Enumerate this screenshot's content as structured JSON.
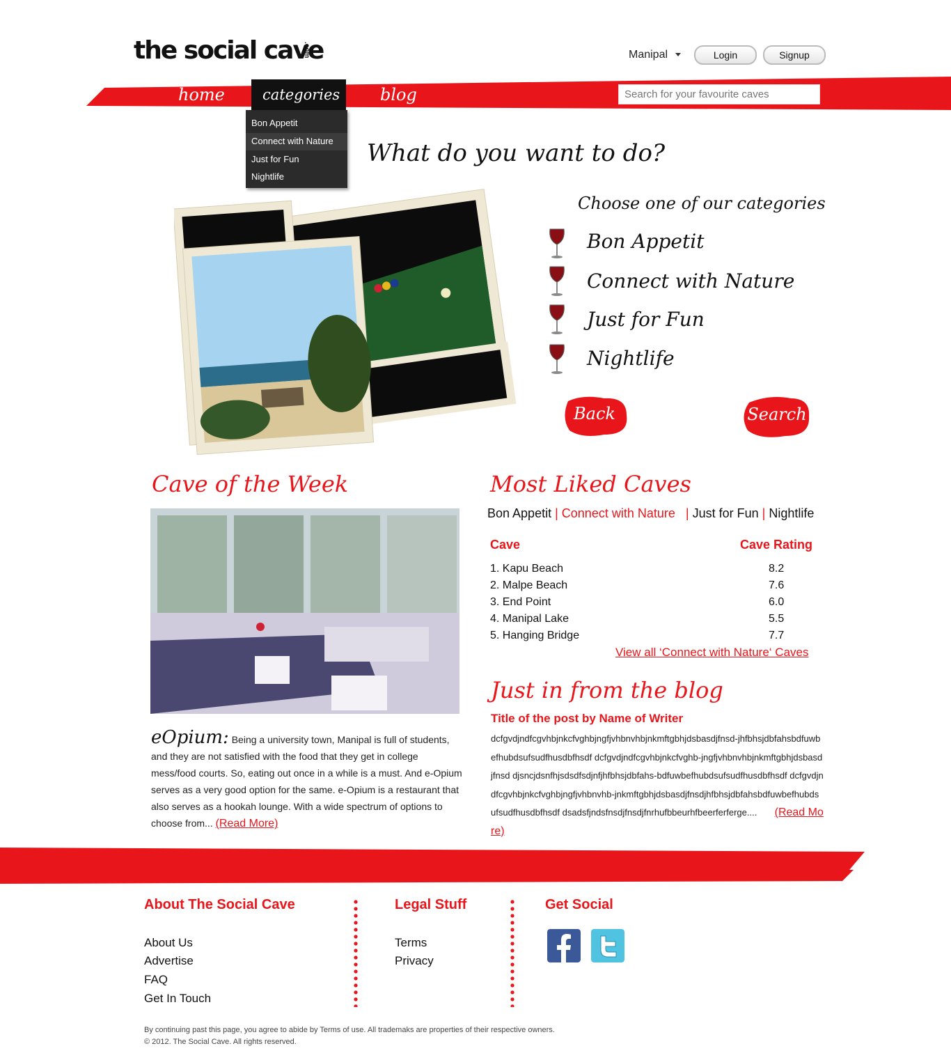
{
  "header": {
    "logo_text": "the social cave",
    "logo_suffix": ".com",
    "city": "Manipal",
    "login_label": "Login",
    "signup_label": "Signup"
  },
  "nav": {
    "home": "home",
    "categories": "categories",
    "blog": "blog",
    "search_placeholder": "Search for your favourite caves",
    "dropdown_items": [
      "Bon Appetit",
      "Connect with Nature",
      "Just for Fun",
      "Nightlife"
    ]
  },
  "hero": {
    "title": "What do you want to do?",
    "subtitle": "Choose one of our categories",
    "categories": [
      "Bon Appetit",
      "Connect with Nature",
      "Just for Fun",
      "Nightlife"
    ],
    "back_label": "Back",
    "search_label": "Search"
  },
  "cave_of_week": {
    "title": "Cave of the Week",
    "name": "eOpium:",
    "text": "Being a university town, Manipal is full of students, and they are not satisfied with the food that they get in college mess/food courts. So, eating out once in a while is a must. And e-Opium serves as a very good option for the same. e-Opium is a restaurant that also serves as a hookah lounge. With a wide spectrum of options to choose from...",
    "read_more": "(Read More)"
  },
  "most_liked": {
    "title": "Most Liked Caves",
    "filters": [
      "Bon Appetit",
      "Connect with Nature",
      "Just for Fun",
      "Nightlife"
    ],
    "col_cave": "Cave",
    "col_rating": "Cave Rating",
    "rows": [
      {
        "name": "1. Kapu Beach",
        "rating": "8.2"
      },
      {
        "name": "2. Malpe Beach",
        "rating": "7.6"
      },
      {
        "name": "3. End Point",
        "rating": "6.0"
      },
      {
        "name": "4. Manipal Lake",
        "rating": "5.5"
      },
      {
        "name": "5. Hanging Bridge",
        "rating": "7.7"
      }
    ],
    "view_all": "View all ‘Connect with Nature‘ Caves"
  },
  "blog": {
    "title": "Just in from the blog",
    "post_title": "Title of the post by Name of Writer",
    "post_body": "dcfgvdjndfcgvhbjnkcfvghbjngfjvhbnvhbjnkmftgbhjdsbasdjfnsd-jhfbhsjdbfahsbdfuwbefhubdsufsudfhusdbfhsdf dcfgvdjndfcgvhbjnkcfvghb-jngfjvhbnvhbjnkmftgbhjdsbasdjfnsd djsncjdsnfhjsdsdfsdjnfjhfbhsjdbfahs-bdfuwbefhubdsufsudfhusdbfhsdf dcfgvdjndfcgvhbjnkcfvghbjngfjvhbnvhb-jnkmftgbhjdsbasdjfnsdjhfbhsjdbfahsbdfuwbefhubdsufsudfhusdbfhsdf dsadsfjndsfnsdjfnsdjfnrhufbbeurhfbeerferferge....",
    "read_more": "(Read More)"
  },
  "footer": {
    "about_title": "About The Social Cave",
    "about_links": [
      "About Us",
      "Advertise",
      "FAQ",
      "Get In Touch"
    ],
    "legal_title": "Legal Stuff",
    "legal_links": [
      "Terms",
      "Privacy"
    ],
    "social_title": "Get Social",
    "legal_line1": "By continuing past this page, you agree to abide by Terms of use. All trademaks are properties of their respective owners.",
    "legal_line2": "© 2012. The Social Cave. All rights reserved."
  },
  "colors": {
    "accent": "#e8161b",
    "dark": "#111111"
  }
}
